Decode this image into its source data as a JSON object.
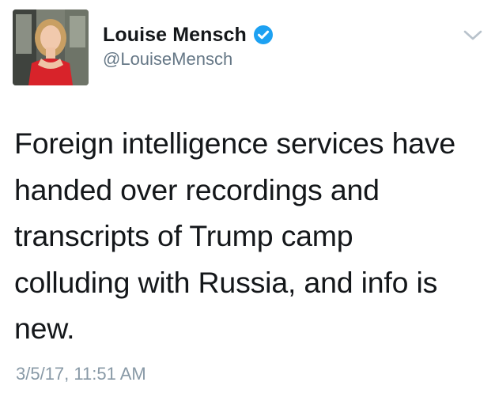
{
  "user": {
    "display_name": "Louise Mensch",
    "handle": "@LouiseMensch",
    "verified": true,
    "avatar_icon": "profile-photo"
  },
  "tweet": {
    "text": "Foreign intelligence services have\nhanded over recordings and\ntranscripts of Trump camp\ncolluding with Russia, and info is\nnew.",
    "timestamp": "3/5/17, 11:51 AM"
  },
  "icons": {
    "verified_badge": "verified-badge-icon",
    "menu": "chevron-down-icon"
  },
  "colors": {
    "verified_blue": "#1da1f2",
    "text_primary": "#14171a",
    "text_secondary": "#657786",
    "timestamp": "#8899a6"
  }
}
